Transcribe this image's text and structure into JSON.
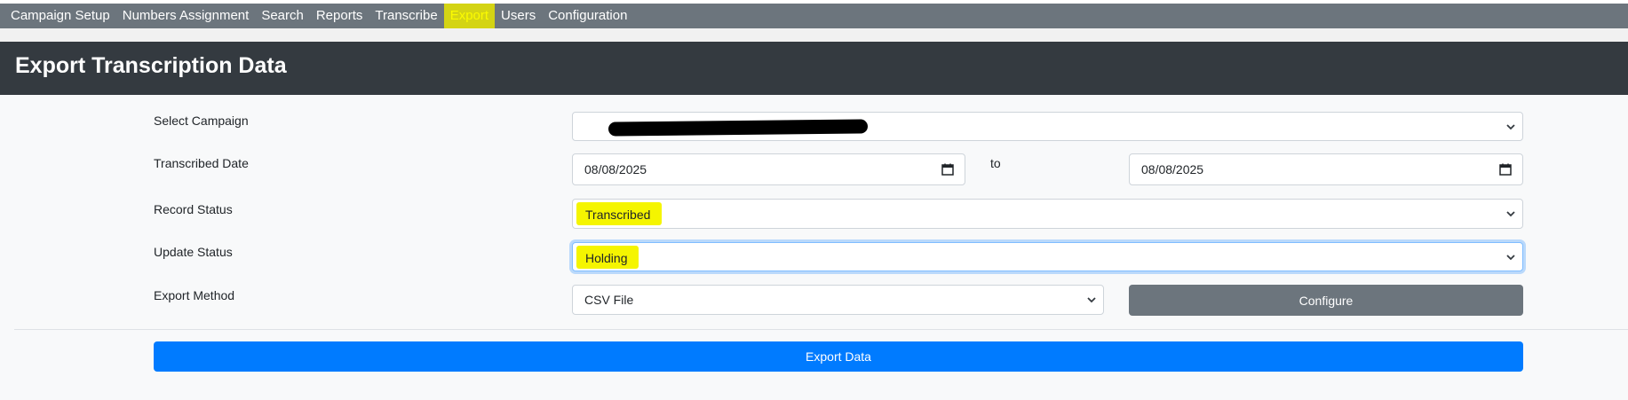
{
  "nav": {
    "items": [
      {
        "label": "Campaign Setup"
      },
      {
        "label": "Numbers Assignment"
      },
      {
        "label": "Search"
      },
      {
        "label": "Reports"
      },
      {
        "label": "Transcribe"
      },
      {
        "label": "Export",
        "active": true
      },
      {
        "label": "Users"
      },
      {
        "label": "Configuration"
      }
    ]
  },
  "page": {
    "title": "Export Transcription Data"
  },
  "form": {
    "campaign": {
      "label": "Select Campaign",
      "value": ""
    },
    "date": {
      "label": "Transcribed Date",
      "from": "08/08/2025",
      "to_label": "to",
      "to": "08/08/2025"
    },
    "record_status": {
      "label": "Record Status",
      "value": "Transcribed"
    },
    "update_status": {
      "label": "Update Status",
      "value": "Holding"
    },
    "export_method": {
      "label": "Export Method",
      "value": "CSV File",
      "configure_label": "Configure"
    },
    "submit_label": "Export Data"
  },
  "colors": {
    "nav_bg": "#6c757d",
    "header_bg": "#343a40",
    "primary": "#007bff",
    "highlight": "#f5f500"
  }
}
